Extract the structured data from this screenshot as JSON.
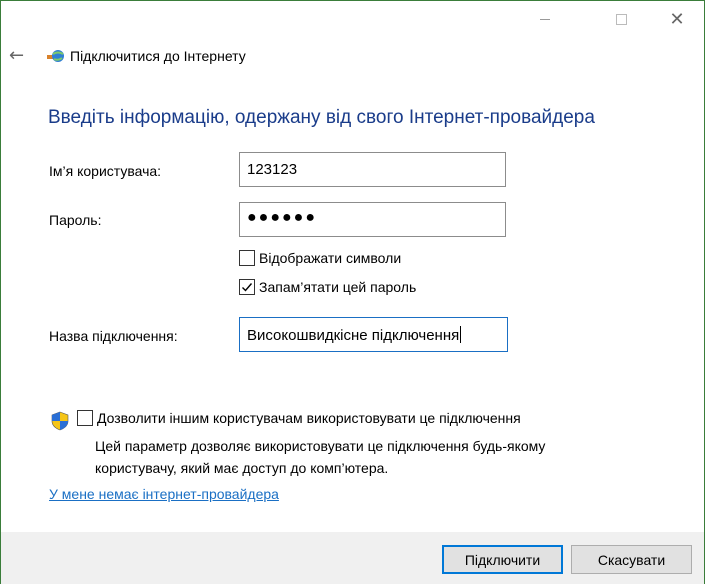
{
  "window": {
    "title": "Підключитися до Інтернету",
    "minimize_icon": "minimize-icon",
    "maximize_icon": "maximize-icon",
    "close_glyph": "✕",
    "back_glyph": "←"
  },
  "heading": "Введіть інформацію, одержану від свого Інтернет-провайдера",
  "form": {
    "username_label": "Ім’я користувача:",
    "username_value": "123123",
    "password_label": "Пароль:",
    "password_masked": "●●●●●●",
    "show_chars_label": "Відображати символи",
    "show_chars_checked": false,
    "remember_label": "Запам’ятати цей пароль",
    "remember_checked": true,
    "connection_name_label": "Назва підключення:",
    "connection_name_value": "Високошвидкісне підключення"
  },
  "sharing": {
    "checkbox_label": "Дозволити іншим користувачам використовувати це підключення",
    "checked": false,
    "description_line1": "Цей параметр дозволяє використовувати це підключення будь-якому",
    "description_line2": "користувачу, який має доступ до комп’ютера."
  },
  "no_isp_link": "У мене немає інтернет-провайдера",
  "buttons": {
    "connect": "Підключити",
    "cancel": "Скасувати"
  },
  "colors": {
    "heading": "#1a3c8a",
    "link": "#1a6fc4",
    "focus_border": "#1a6fc4",
    "window_border": "#3a7d3a"
  }
}
